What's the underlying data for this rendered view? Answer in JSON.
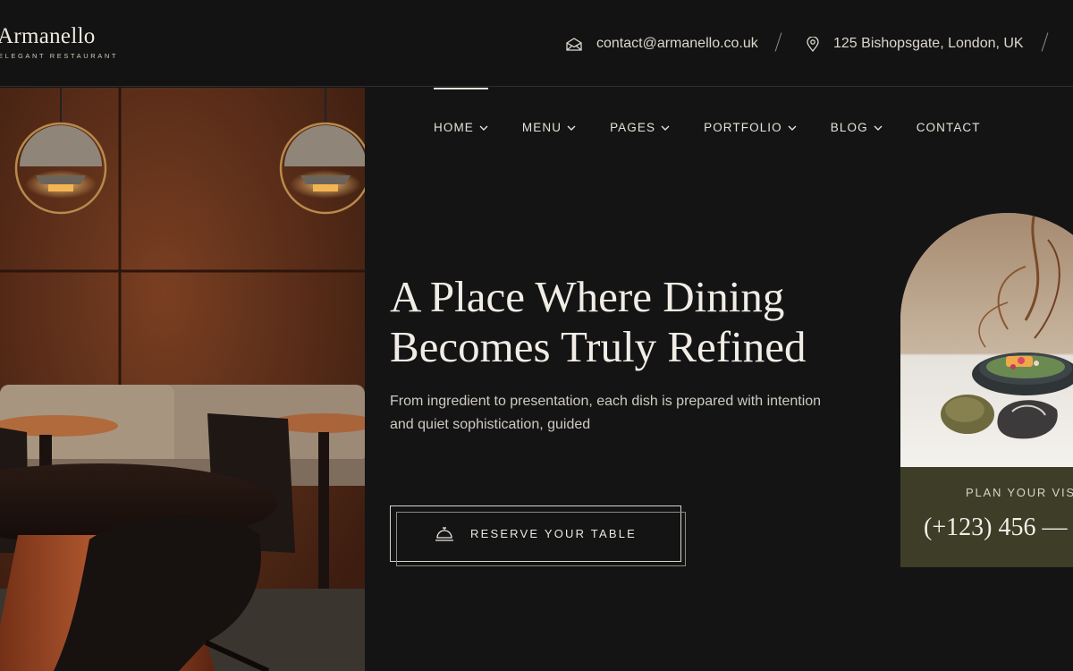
{
  "brand": {
    "name": "Armanello",
    "tagline": "ELEGANT RESTAURANT"
  },
  "topbar": {
    "email": "contact@armanello.co.uk",
    "email_icon": "envelope-icon",
    "address": "125 Bishopsgate, London, UK",
    "address_icon": "map-pin-icon"
  },
  "nav": {
    "items": [
      {
        "label": "HOME",
        "has_dropdown": true,
        "active": true
      },
      {
        "label": "MENU",
        "has_dropdown": true
      },
      {
        "label": "PAGES",
        "has_dropdown": true
      },
      {
        "label": "PORTFOLIO",
        "has_dropdown": true
      },
      {
        "label": "BLOG",
        "has_dropdown": true
      },
      {
        "label": "CONTACT",
        "has_dropdown": false
      }
    ]
  },
  "hero": {
    "title_line1": "A Place Where Dining",
    "title_line2": "Becomes Truly Refined",
    "subtitle_line1": "From ingredient to presentation, each dish is prepared with intention",
    "subtitle_line2": "and quiet sophistication, guided",
    "cta_label": "RESERVE YOUR TABLE",
    "cta_icon": "service-bell-icon"
  },
  "visit_card": {
    "label": "PLAN YOUR VISI",
    "phone": "(+123) 456 —"
  },
  "colors": {
    "background": "#141414",
    "card_panel": "#3d3d28",
    "text_light": "#f1ede6"
  }
}
